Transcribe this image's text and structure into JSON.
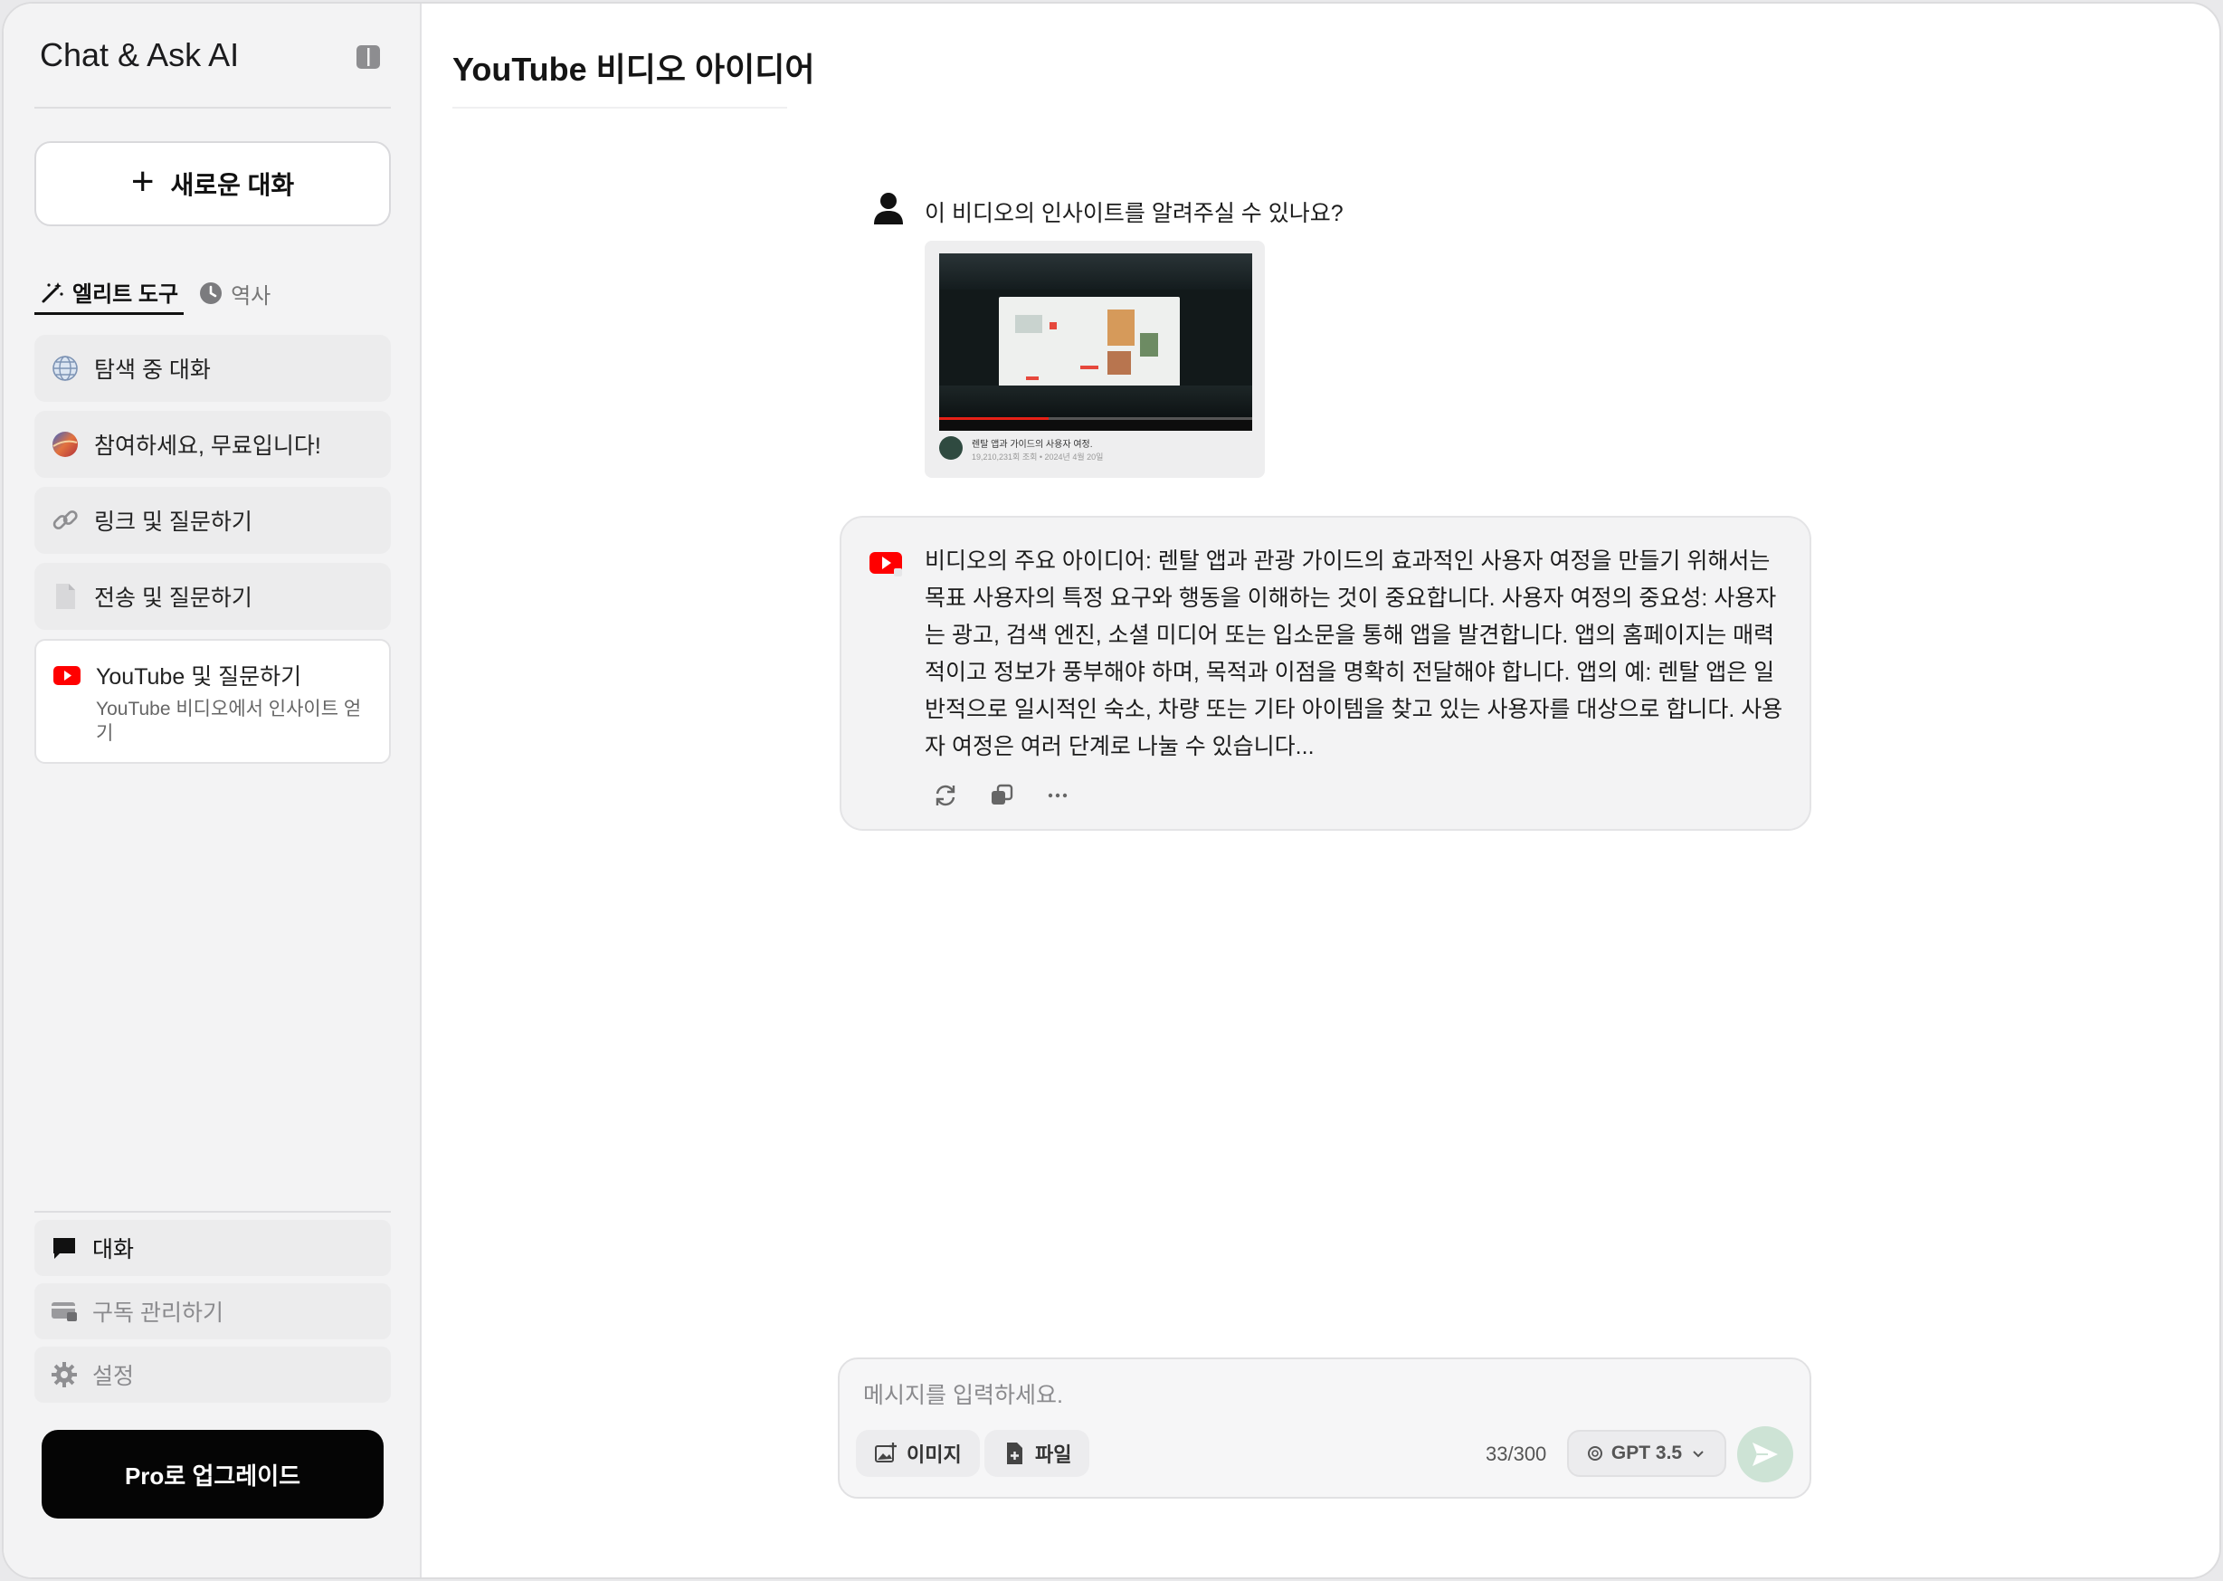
{
  "sidebar": {
    "app_title": "Chat & Ask AI",
    "new_chat_label": "새로운 대화",
    "tabs": [
      {
        "label": "엘리트 도구"
      },
      {
        "label": "역사"
      }
    ],
    "tools": [
      {
        "label": "탐색 중 대화",
        "icon": "globe-icon"
      },
      {
        "label": "참여하세요, 무료입니다!",
        "icon": "planet-icon"
      },
      {
        "label": "링크 및 질문하기",
        "icon": "link-icon"
      },
      {
        "label": "전송 및 질문하기",
        "icon": "document-icon"
      },
      {
        "label": "YouTube 및 질문하기",
        "description": "YouTube 비디오에서 인사이트 얻기",
        "icon": "youtube-icon"
      }
    ],
    "nav": [
      {
        "label": "대화",
        "icon": "chat-bubble-icon"
      },
      {
        "label": "구독 관리하기",
        "icon": "card-lock-icon"
      },
      {
        "label": "설정",
        "icon": "gear-icon"
      }
    ],
    "upgrade_label": "Pro로 업그레이드"
  },
  "main": {
    "title": "YouTube 비디오 아이디어",
    "user_message": "이 비디오의 인사이트를 알려주실 수 있나요?",
    "video_thumbnail": {
      "title": "렌탈 앱과 가이드의 사용자 여정.",
      "meta": "19,210,231회 조회 • 2024년 4월 20일"
    },
    "ai_message": "비디오의 주요 아이디어: 렌탈 앱과 관광 가이드의 효과적인 사용자 여정을 만들기 위해서는 목표 사용자의 특정 요구와 행동을 이해하는 것이 중요합니다. 사용자 여정의 중요성: 사용자는 광고, 검색 엔진, 소셜 미디어 또는 입소문을 통해 앱을 발견합니다. 앱의 홈페이지는 매력적이고 정보가 풍부해야 하며, 목적과 이점을 명확히 전달해야 합니다. 앱의 예: 렌탈 앱은 일반적으로 일시적인 숙소, 차량 또는 기타 아이템을 찾고 있는 사용자를 대상으로 합니다. 사용자 여정은 여러 단계로 나눌 수 있습니다..."
  },
  "composer": {
    "placeholder": "메시지를 입력하세요.",
    "value": "",
    "image_label": "이미지",
    "file_label": "파일",
    "counter": "33/300",
    "model": "GPT 3.5"
  },
  "colors": {
    "youtube_red": "#ff0000",
    "send_button": "#cde3d5",
    "upgrade_bg": "#050505"
  }
}
